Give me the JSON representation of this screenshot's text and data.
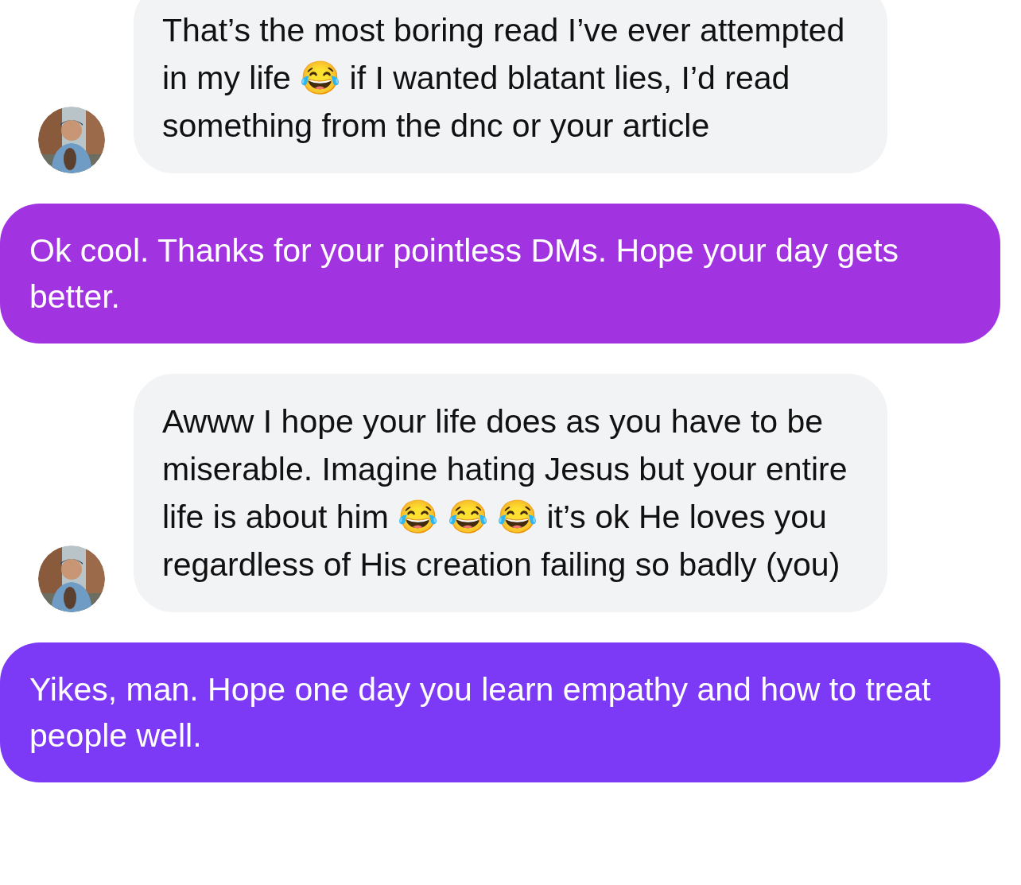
{
  "messages": [
    {
      "kind": "incoming",
      "text": "That’s the most boring read I’ve ever attempted in my life 😂 if I wanted blatant lies, I’d read something from the dnc or your article"
    },
    {
      "kind": "outgoing",
      "color": "#a133e1",
      "text": "Ok cool. Thanks for your pointless DMs. Hope your day gets better."
    },
    {
      "kind": "incoming",
      "text": "Awww I hope your life does as you have to be miserable. Imagine hating Jesus but your entire life is about him 😂 😂 😂 it’s ok He loves you regardless of His creation failing so badly (you)"
    },
    {
      "kind": "outgoing",
      "color": "#7c3af6",
      "text": "Yikes, man. Hope one day you learn empathy and how to treat people well."
    }
  ]
}
